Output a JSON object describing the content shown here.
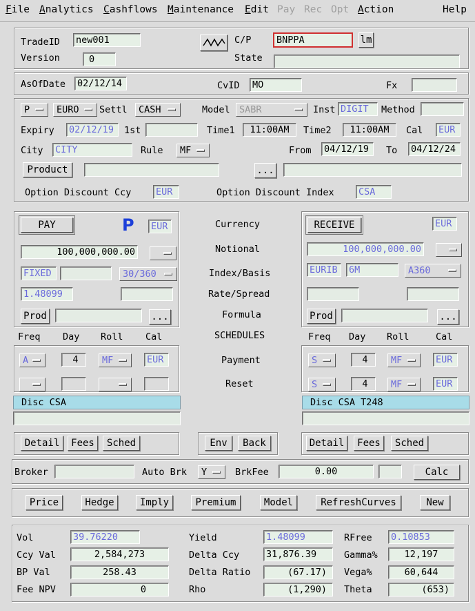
{
  "menu": {
    "file": {
      "u": "F",
      "rest": "ile"
    },
    "analytics": {
      "u": "A",
      "rest": "nalytics"
    },
    "cashflows": {
      "u": "C",
      "rest": "ashflows"
    },
    "maintenance": {
      "u": "M",
      "rest": "aintenance"
    },
    "edit": {
      "u": "E",
      "rest": "dit"
    },
    "pay": "Pay",
    "rec": "Rec",
    "opt": "Opt",
    "action": {
      "u": "A",
      "rest": "ction"
    },
    "help": "Help"
  },
  "header": {
    "tradeid_label": "TradeID",
    "tradeid_value": "new001",
    "version_label": "Version",
    "version_value": "0",
    "cp_label": "C/P",
    "cp_value": "BNPPA",
    "lm_label": "lm",
    "state_label": "State",
    "state_value": ""
  },
  "asof": {
    "asof_label": "AsOfDate",
    "asof_value": "02/12/14",
    "cvid_label": "CvID",
    "cvid_value": "MO",
    "fx_label": "Fx",
    "fx_value": ""
  },
  "terms": {
    "type": "P",
    "currency": "EURO",
    "settl_label": "Settl",
    "settl_value": "CASH",
    "model_label": "Model",
    "model_value": "SABR",
    "inst_label": "Inst",
    "inst_value": "DIGIT",
    "method_label": "Method",
    "method_value": "",
    "expiry_label": "Expiry",
    "expiry_value": "02/12/19",
    "first_label": "1st",
    "first_value": "",
    "time1_label": "Time1",
    "time1_value": "11:00AM",
    "time2_label": "Time2",
    "time2_value": "11:00AM",
    "cal_label": "Cal",
    "cal_value": "EUR",
    "city_label": "City",
    "city_value": "CITY",
    "rule_label": "Rule",
    "rule_value": "MF",
    "from_label": "From",
    "from_value": "04/12/19",
    "to_label": "To",
    "to_value": "04/12/24",
    "product_label": "Product",
    "product_value": "",
    "ellipsis": "...",
    "product_desc": "",
    "odc_label": "Option Discount Ccy",
    "odc_value": "EUR",
    "odi_label": "Option Discount Index",
    "odi_value": "CSA"
  },
  "pay": {
    "button": "PAY",
    "flag": "P",
    "ccy": "EUR",
    "notional": "100,000,000.00",
    "index": "FIXED",
    "index2": "",
    "basis": "30/360",
    "rate": "1.48099",
    "spread": "",
    "prod_label": "Prod",
    "prod_value": "",
    "ellipsis": "...",
    "freq_label": "Freq",
    "day_label": "Day",
    "roll_label": "Roll",
    "cal_label": "Cal",
    "pay_freq": "A",
    "pay_day": "4",
    "pay_roll": "MF",
    "pay_cal": "EUR",
    "reset_freq": "",
    "reset_day": "",
    "reset_roll": "",
    "reset_cal": "",
    "disc": "Disc CSA",
    "disc2": "",
    "detail": "Detail",
    "fees": "Fees",
    "sched": "Sched"
  },
  "middle": {
    "currency": "Currency",
    "notional": "Notional",
    "index_basis": "Index/Basis",
    "rate_spread": "Rate/Spread",
    "formula": "Formula",
    "schedules": "SCHEDULES",
    "payment": "Payment",
    "reset": "Reset",
    "env": "Env",
    "back": "Back"
  },
  "receive": {
    "button": "RECEIVE",
    "ccy": "EUR",
    "notional": "100,000,000.00",
    "index": "EURIB",
    "tenor": "6M",
    "basis": "A360",
    "rate": "",
    "spread": "",
    "prod_label": "Prod",
    "prod_value": "",
    "ellipsis": "...",
    "freq_label": "Freq",
    "day_label": "Day",
    "roll_label": "Roll",
    "cal_label": "Cal",
    "pay_freq": "S",
    "pay_day": "4",
    "pay_roll": "MF",
    "pay_cal": "EUR",
    "reset_freq": "S",
    "reset_day": "4",
    "reset_roll": "MF",
    "reset_cal": "EUR",
    "disc": "Disc CSA T248",
    "disc2": "",
    "detail": "Detail",
    "fees": "Fees",
    "sched": "Sched"
  },
  "broker": {
    "broker_label": "Broker",
    "broker_value": "",
    "autobrk_label": "Auto Brk",
    "autobrk_value": "Y",
    "brkfee_label": "BrkFee",
    "brkfee_value": "0.00",
    "brkfee_ccy": "",
    "calc": "Calc"
  },
  "actions": [
    "Price",
    "Hedge",
    "Imply",
    "Premium",
    "Model",
    "RefreshCurves",
    "New"
  ],
  "results": {
    "vol_label": "Vol",
    "vol": "39.76220",
    "ccyval_label": "Ccy Val",
    "ccyval": "2,584,273",
    "bpval_label": "BP Val",
    "bpval": "258.43",
    "feenpv_label": "Fee NPV",
    "feenpv": "0",
    "yield_label": "Yield",
    "yield": "1.48099",
    "deltaccy_label": "Delta Ccy",
    "deltaccy": "31,876.39",
    "deltaratio_label": "Delta Ratio",
    "deltaratio": "(67.17)",
    "rho_label": "Rho",
    "rho": "(1,290)",
    "rfree_label": "RFree",
    "rfree": "0.10853",
    "gamma_label": "Gamma%",
    "gamma": "12,197",
    "vega_label": "Vega%",
    "vega": "60,644",
    "theta_label": "Theta",
    "theta": "(653)"
  }
}
